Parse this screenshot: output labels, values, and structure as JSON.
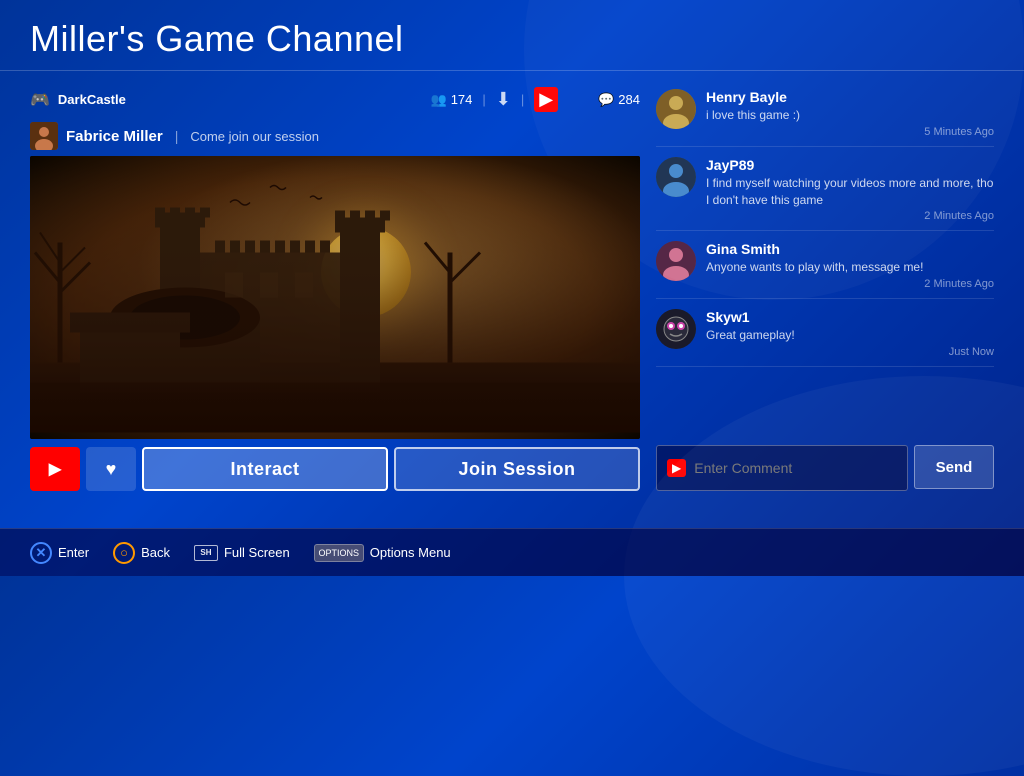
{
  "page": {
    "title": "Miller's Game Channel"
  },
  "stream": {
    "game": "DarkCastle",
    "followers": "174",
    "comment_count": "284",
    "streamer_name": "Fabrice Miller",
    "description": "Come join our session"
  },
  "comments": [
    {
      "id": "henry",
      "name": "Henry Bayle",
      "text": "i love this game :)",
      "time": "5 Minutes Ago",
      "avatar_emoji": "👤"
    },
    {
      "id": "jay",
      "name": "JayP89",
      "text": "I find myself watching your videos more and more, tho I don't have this game",
      "time": "2 Minutes Ago",
      "avatar_emoji": "👤"
    },
    {
      "id": "gina",
      "name": "Gina Smith",
      "text": "Anyone wants to play with, message me!",
      "time": "2 Minutes Ago",
      "avatar_emoji": "👤"
    },
    {
      "id": "skyw",
      "name": "Skyw1",
      "text": "Great gameplay!",
      "time": "Just Now",
      "avatar_emoji": "👾"
    }
  ],
  "actions": {
    "interact_label": "Interact",
    "join_session_label": "Join Session"
  },
  "comment_input": {
    "placeholder": "Enter Comment",
    "send_label": "Send"
  },
  "footer": {
    "enter_label": "Enter",
    "back_label": "Back",
    "fullscreen_label": "Full Screen",
    "options_label": "Options Menu"
  }
}
